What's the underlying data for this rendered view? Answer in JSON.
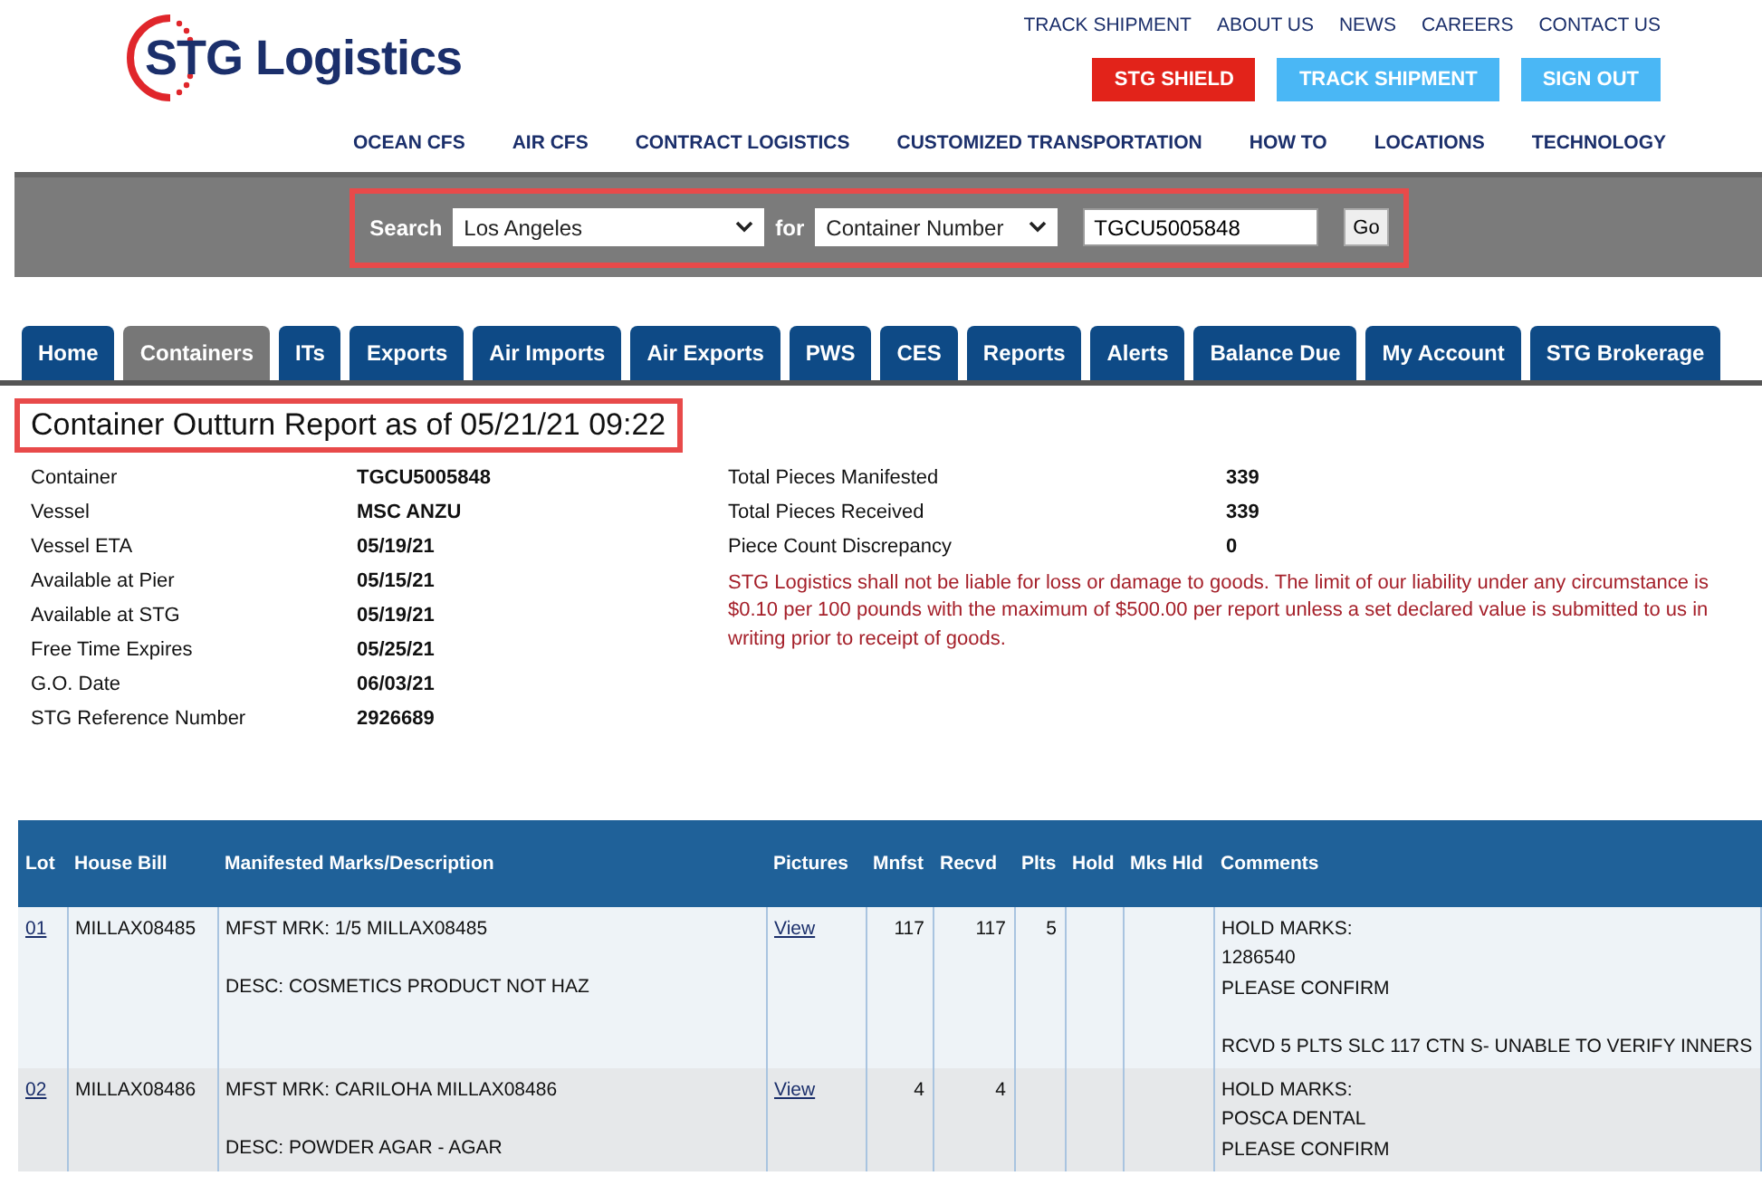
{
  "logo": {
    "text": "STG Logistics"
  },
  "top_links": [
    "TRACK SHIPMENT",
    "ABOUT US",
    "NEWS",
    "CAREERS",
    "CONTACT US"
  ],
  "header_buttons": [
    {
      "label": "STG SHIELD",
      "kind": "red"
    },
    {
      "label": "TRACK SHIPMENT",
      "kind": "blue"
    },
    {
      "label": "SIGN OUT",
      "kind": "blue"
    }
  ],
  "main_nav": [
    "OCEAN CFS",
    "AIR CFS",
    "CONTRACT LOGISTICS",
    "CUSTOMIZED TRANSPORTATION",
    "HOW TO",
    "LOCATIONS",
    "TECHNOLOGY"
  ],
  "search": {
    "label": "Search",
    "location": "Los Angeles",
    "for_label": "for",
    "type": "Container Number",
    "value": "TGCU5005848",
    "button": "Go"
  },
  "tabs": [
    {
      "label": "Home",
      "selected": false
    },
    {
      "label": "Containers",
      "selected": true
    },
    {
      "label": "ITs",
      "selected": false
    },
    {
      "label": "Exports",
      "selected": false
    },
    {
      "label": "Air Imports",
      "selected": false
    },
    {
      "label": "Air Exports",
      "selected": false
    },
    {
      "label": "PWS",
      "selected": false
    },
    {
      "label": "CES",
      "selected": false
    },
    {
      "label": "Reports",
      "selected": false
    },
    {
      "label": "Alerts",
      "selected": false
    },
    {
      "label": "Balance Due",
      "selected": false
    },
    {
      "label": "My Account",
      "selected": false
    },
    {
      "label": "STG Brokerage",
      "selected": false
    }
  ],
  "title": "Container Outturn Report as of 05/21/21 09:22",
  "details_left": [
    {
      "label": "Container",
      "value": "TGCU5005848"
    },
    {
      "label": "Vessel",
      "value": "MSC ANZU"
    },
    {
      "label": "Vessel ETA",
      "value": "05/19/21"
    },
    {
      "label": "Available at Pier",
      "value": "05/15/21"
    },
    {
      "label": "Available at STG",
      "value": "05/19/21"
    },
    {
      "label": "Free Time Expires",
      "value": "05/25/21"
    },
    {
      "label": "G.O. Date",
      "value": "06/03/21"
    },
    {
      "label": "STG Reference Number",
      "value": "2926689"
    }
  ],
  "details_right": [
    {
      "label": "Total Pieces Manifested",
      "value": "339"
    },
    {
      "label": "Total Pieces Received",
      "value": "339"
    },
    {
      "label": "Piece Count Discrepancy",
      "value": "0"
    }
  ],
  "disclaimer": "STG Logistics shall not be liable for loss or damage to goods. The limit of our liability under any circumstance is $0.10 per 100 pounds with the maximum of $500.00 per report unless a set declared value is submitted to us in writing prior to receipt of goods.",
  "table": {
    "columns": [
      "Lot",
      "House Bill",
      "Manifested Marks/Description",
      "Pictures",
      "Mnfst",
      "Recvd",
      "Plts",
      "Hold",
      "Mks Hld",
      "Comments"
    ],
    "rows": [
      {
        "lot": "01",
        "house_bill": "MILLAX08485",
        "marks": "MFST MRK: 1/5 MILLAX08485",
        "desc": "DESC: COSMETICS PRODUCT NOT HAZ",
        "pictures": "View",
        "mnfst": "117",
        "recvd": "117",
        "plts": "5",
        "comments": [
          [
            "HOLD MARKS:",
            "1286540",
            "PLEASE CONFIRM"
          ],
          [
            "RCVD 5 PLTS SLC 117 CTN S- UNABLE TO VERIFY INNERS"
          ]
        ]
      },
      {
        "lot": "02",
        "house_bill": "MILLAX08486",
        "marks": "MFST MRK: CARILOHA MILLAX08486",
        "desc": "DESC: POWDER AGAR - AGAR",
        "pictures": "View",
        "mnfst": "4",
        "recvd": "4",
        "comments": [
          [
            "HOLD MARKS:",
            "POSCA DENTAL",
            "PLEASE CONFIRM"
          ]
        ]
      }
    ]
  }
}
